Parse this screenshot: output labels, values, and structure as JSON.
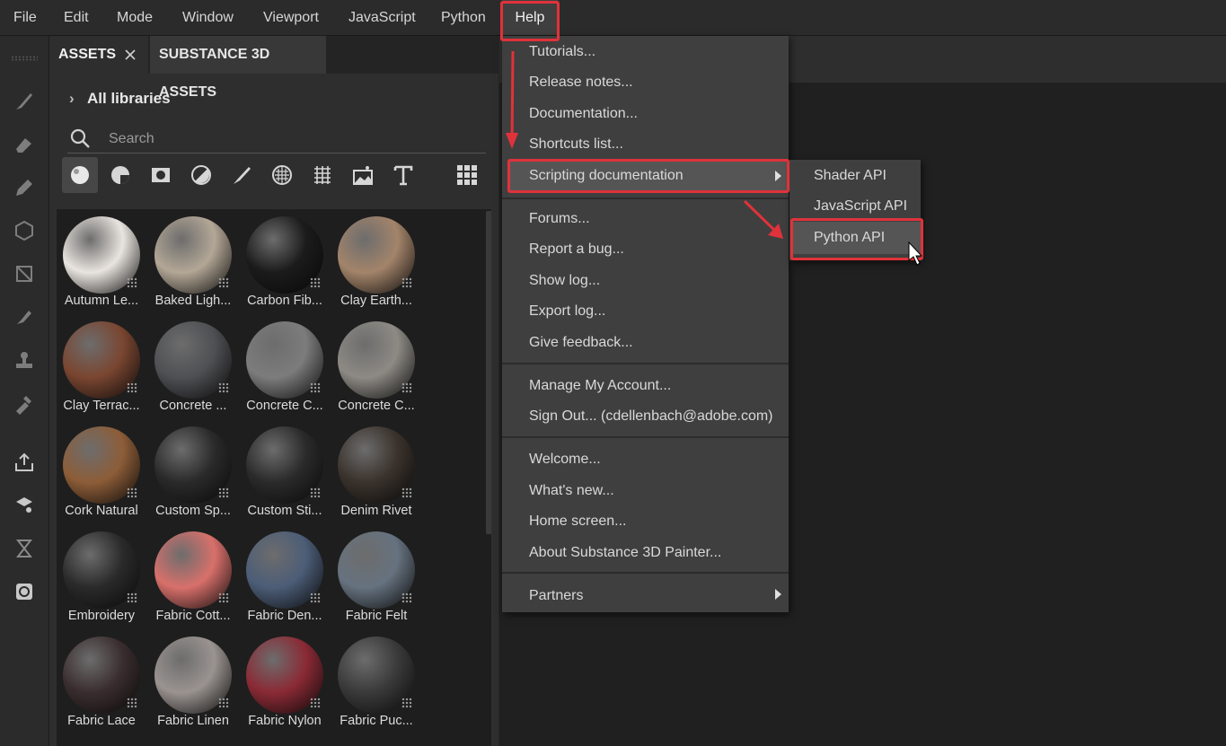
{
  "menubar": {
    "items": [
      "File",
      "Edit",
      "Mode",
      "Window",
      "Viewport",
      "JavaScript",
      "Python",
      "Help"
    ]
  },
  "assets_panel": {
    "tabs": [
      "ASSETS",
      "SUBSTANCE 3D ASSETS"
    ],
    "libraries_label": "All libraries",
    "search_placeholder": "Search",
    "filters": [
      "materials-sphere-icon",
      "smart-materials-icon",
      "textures-icon",
      "filters-icon",
      "brushes-icon",
      "alphas-icon",
      "grid-pattern-icon",
      "environments-icon",
      "text-icon",
      "grid-view-icon"
    ],
    "assets": [
      {
        "label": "Autumn Le...",
        "color": "#e9e4df"
      },
      {
        "label": "Baked Ligh...",
        "color": "#b3a796"
      },
      {
        "label": "Carbon Fib...",
        "color": "#1b1b1b"
      },
      {
        "label": "Clay Earth...",
        "color": "#a3846a"
      },
      {
        "label": "Clay Terrac...",
        "color": "#7a4631"
      },
      {
        "label": "Concrete ...",
        "color": "#4f5053"
      },
      {
        "label": "Concrete C...",
        "color": "#7c7c7c"
      },
      {
        "label": "Concrete C...",
        "color": "#8d8a84"
      },
      {
        "label": "Cork Natural",
        "color": "#8d5d38"
      },
      {
        "label": "Custom Sp...",
        "color": "#2a2a2a"
      },
      {
        "label": "Custom Sti...",
        "color": "#2a2a2a"
      },
      {
        "label": "Denim Rivet",
        "color": "#3a322c"
      },
      {
        "label": "Embroidery",
        "color": "#2a2a2a"
      },
      {
        "label": "Fabric Cott...",
        "color": "#d8706b"
      },
      {
        "label": "Fabric Den...",
        "color": "#4c5d77"
      },
      {
        "label": "Fabric Felt",
        "color": "#66727f"
      },
      {
        "label": "Fabric Lace",
        "color": "#3a2d2f"
      },
      {
        "label": "Fabric Linen",
        "color": "#9a9390"
      },
      {
        "label": "Fabric Nylon",
        "color": "#8a2a35"
      },
      {
        "label": "Fabric Puc...",
        "color": "#3a3a3a"
      }
    ]
  },
  "help_menu": {
    "groups": [
      [
        "Tutorials...",
        "Release notes...",
        "Documentation...",
        "Shortcuts list...",
        "Scripting documentation"
      ],
      [
        "Forums...",
        "Report a bug...",
        "Show log...",
        "Export log...",
        "Give feedback..."
      ],
      [
        "Manage My Account...",
        "Sign Out... (cdellenbach@adobe.com)"
      ],
      [
        "Welcome...",
        "What's new...",
        "Home screen...",
        "About Substance 3D Painter..."
      ],
      [
        "Partners"
      ]
    ]
  },
  "scripting_submenu": {
    "items": [
      "Shader API",
      "JavaScript API",
      "Python API"
    ]
  },
  "colors": {
    "highlight_box": "#e0323a",
    "menu_bg": "#3f3f3f",
    "hover_bg": "#555555"
  }
}
